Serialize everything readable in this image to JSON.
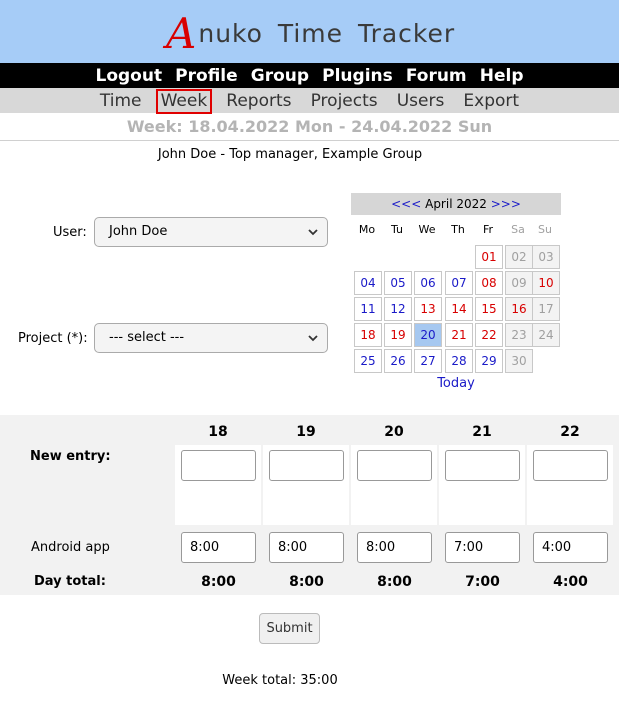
{
  "app": {
    "logo_letter": "A",
    "logo_rest": "nuko Time Tracker"
  },
  "topnav": [
    "Logout",
    "Profile",
    "Group",
    "Plugins",
    "Forum",
    "Help"
  ],
  "subnav": {
    "items": [
      "Time",
      "Week",
      "Reports",
      "Projects",
      "Users",
      "Export"
    ],
    "active": "Week"
  },
  "week_title": "Week: 18.04.2022 Mon - 24.04.2022 Sun",
  "user_line": "John Doe - Top manager, Example Group",
  "form": {
    "user_label": "User:",
    "user_value": "John Doe",
    "project_label": "Project (*):",
    "project_value": "--- select ---"
  },
  "calendar": {
    "prev": "<<<",
    "month": "April 2022",
    "next": ">>>",
    "weekdays": [
      "Mo",
      "Tu",
      "We",
      "Th",
      "Fr",
      "Sa",
      "Su"
    ],
    "weeks": [
      [
        "",
        "",
        "",
        "",
        "01",
        "02",
        "03"
      ],
      [
        "04",
        "05",
        "06",
        "07",
        "08",
        "09",
        "10"
      ],
      [
        "11",
        "12",
        "13",
        "14",
        "15",
        "16",
        "17"
      ],
      [
        "18",
        "19",
        "20",
        "21",
        "22",
        "23",
        "24"
      ],
      [
        "25",
        "26",
        "27",
        "28",
        "29",
        "30",
        ""
      ]
    ],
    "today_link": "Today",
    "colors": {
      "blue": "#1a1ac8",
      "red": "#d80000",
      "grey": "#a0a0a0",
      "today_bg": "#a6c8f0"
    }
  },
  "week_grid": {
    "days": [
      "18",
      "19",
      "20",
      "21",
      "22"
    ],
    "new_entry_label": "New entry:",
    "rows": [
      {
        "label": "Android app",
        "values": [
          "8:00",
          "8:00",
          "8:00",
          "7:00",
          "4:00"
        ]
      }
    ],
    "day_total_label": "Day total:",
    "day_totals": [
      "8:00",
      "8:00",
      "8:00",
      "7:00",
      "4:00"
    ]
  },
  "submit_label": "Submit",
  "week_total": "Week total: 35:00"
}
